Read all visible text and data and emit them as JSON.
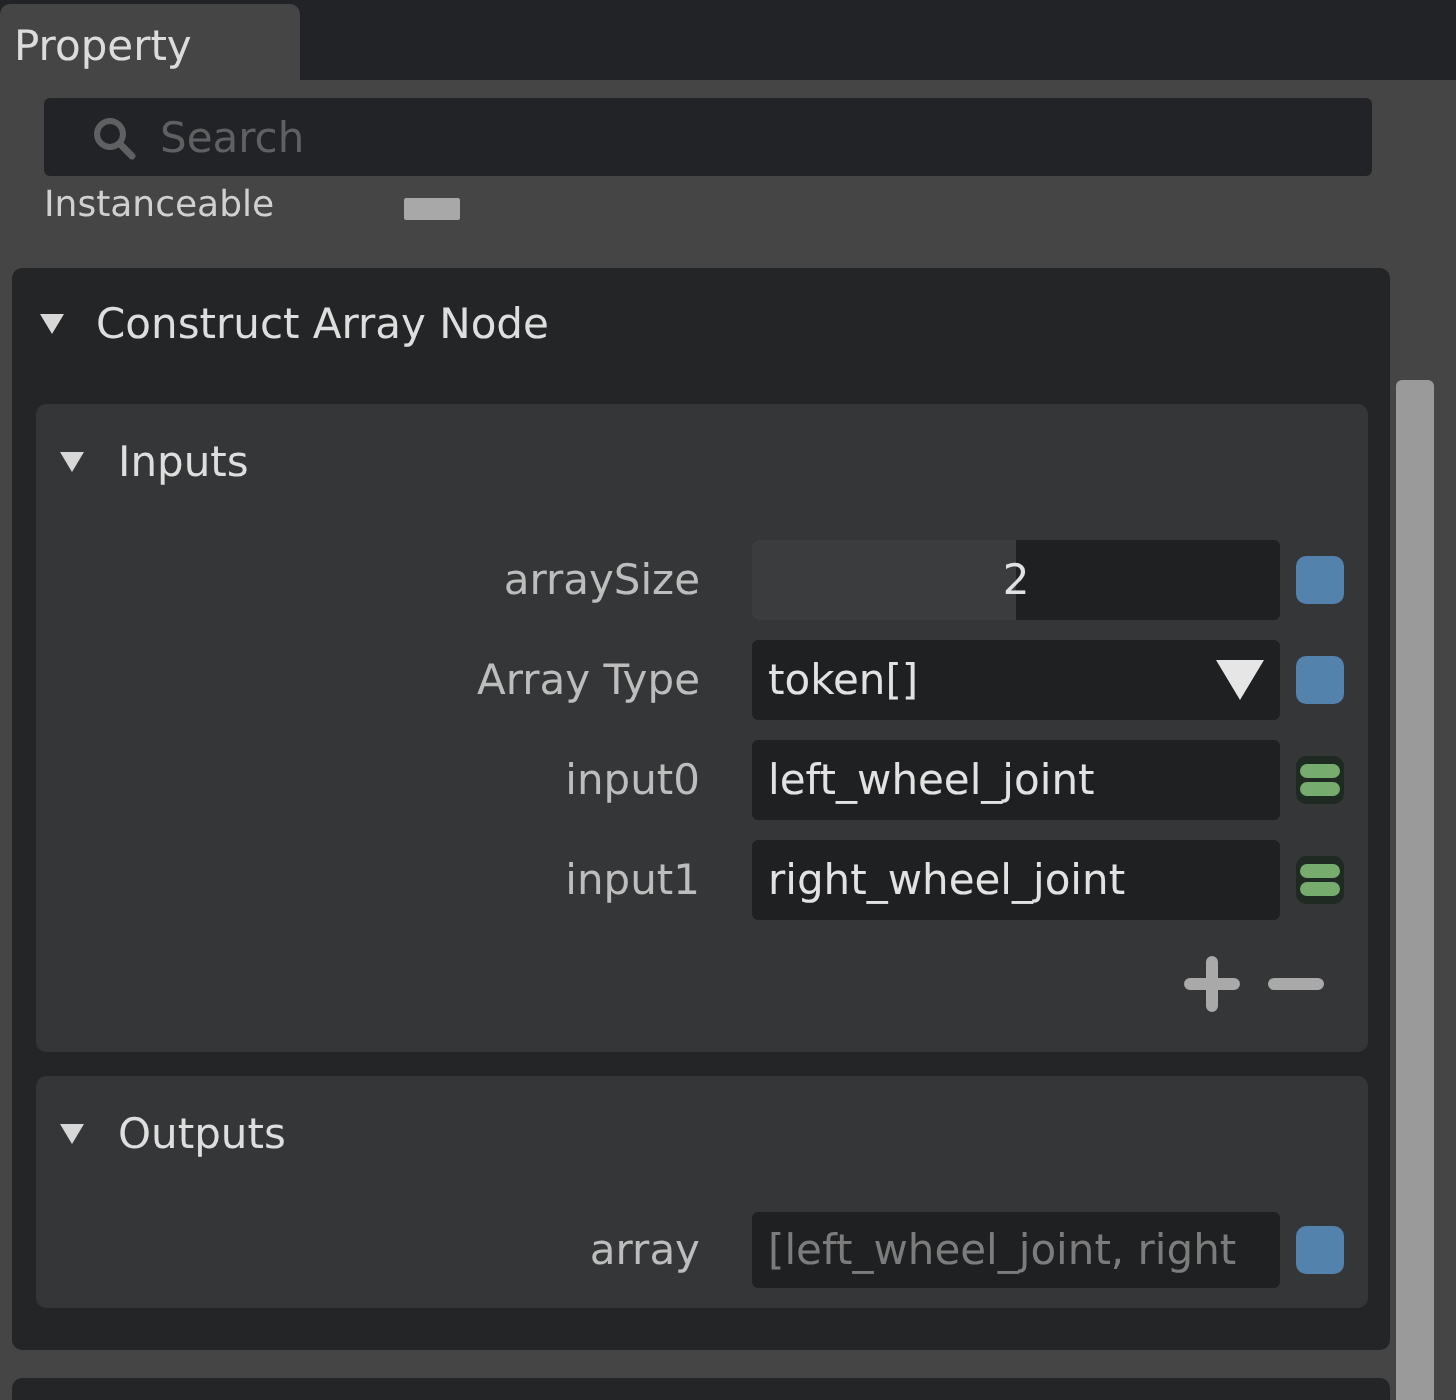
{
  "tab": {
    "label": "Property",
    "selected": true
  },
  "search": {
    "placeholder": "Search"
  },
  "properties": [
    {
      "label": "Instanceable",
      "checked": false
    }
  ],
  "node": {
    "title": "Construct Array Node",
    "expanded": true,
    "sections": [
      {
        "title": "Inputs",
        "expanded": true,
        "add_remove": true,
        "rows": [
          {
            "label": "arraySize",
            "kind": "slider",
            "value": "2",
            "level": 0.5,
            "array_port": false
          },
          {
            "label": "Array Type",
            "kind": "dropdown",
            "value": "token[]",
            "array_port": false
          },
          {
            "label": "input0",
            "kind": "text",
            "value": "left_wheel_joint",
            "array_port": true
          },
          {
            "label": "input1",
            "kind": "text",
            "value": "right_wheel_joint",
            "array_port": true
          }
        ]
      },
      {
        "title": "Outputs",
        "expanded": true,
        "add_remove": false,
        "rows": [
          {
            "label": "array",
            "kind": "readonly",
            "value": "[left_wheel_joint, right",
            "array_port": false
          }
        ]
      }
    ]
  }
}
